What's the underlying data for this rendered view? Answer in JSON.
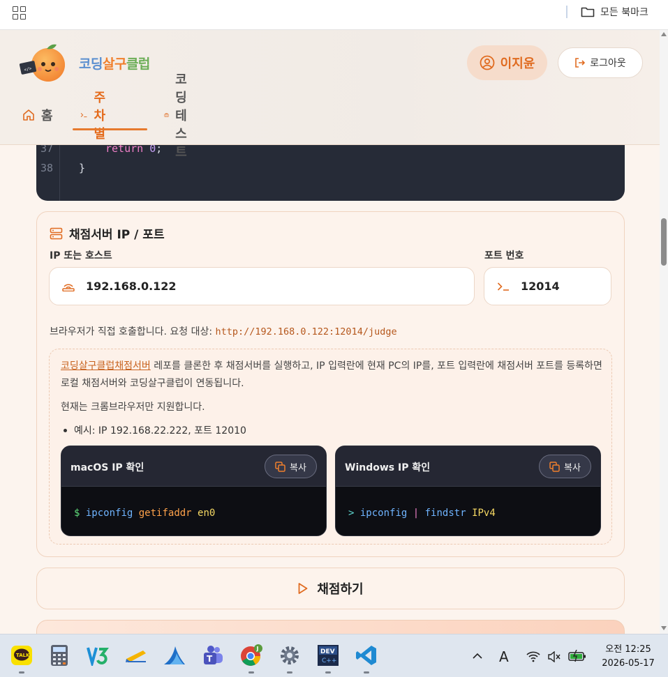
{
  "bookmarks_bar": {
    "folder_label": "모든 북마크"
  },
  "header": {
    "logo": {
      "part1": "코딩",
      "part2": "살구",
      "part3": "클럽"
    },
    "user_name": "이지윤",
    "logout_label": "로그아웃",
    "nav": [
      {
        "label": "홈",
        "icon": "home-icon"
      },
      {
        "label": "주차별",
        "icon": "terminal-icon",
        "active": true
      },
      {
        "label": "코딩테스트",
        "icon": "briefcase-icon"
      }
    ]
  },
  "code": {
    "lines": [
      {
        "num": "37",
        "keyword": "return",
        "value": "0",
        "suffix": ";"
      },
      {
        "num": "38",
        "text": "}"
      }
    ]
  },
  "server": {
    "title": "채점서버 IP / 포트",
    "ip_label": "IP 또는 호스트",
    "ip_value": "192.168.0.122",
    "port_label": "포트 번호",
    "port_value": "12014",
    "hint_prefix": "브라우저가 직접 호출합니다. 요청 대상:",
    "hint_url": "http://192.168.0.122:12014/judge",
    "notice": {
      "link": "코딩살구클럽채점서버",
      "text1": " 레포를 클론한 후 채점서버를 실행하고, IP 입력란에 현재 PC의 IP를, 포트 입력란에 채점서버 포트를 등록하면 로컬 채점서버와 코딩살구클럽이 연동됩니다.",
      "text2": "현재는 크롬브라우저만 지원합니다.",
      "example": "예시: IP 192.168.22.222, 포트 12010"
    },
    "terminals": [
      {
        "title": "macOS IP 확인",
        "copy": "복사",
        "prompt": "$",
        "cmd": "ipconfig",
        "arg1": "getifaddr",
        "arg2": "en0"
      },
      {
        "title": "Windows IP 확인",
        "copy": "복사",
        "prompt": ">",
        "cmd": "ipconfig",
        "pipe": "|",
        "arg1": "findstr",
        "arg2": "IPv4"
      }
    ]
  },
  "grade_button": "채점하기",
  "taskbar": {
    "apps": [
      "kakaotalk",
      "calculator",
      "v3",
      "notes",
      "browser",
      "teams",
      "chrome",
      "settings",
      "devcpp",
      "vscode"
    ],
    "ime": "A",
    "time": "오전 12:25",
    "date": "2026-05-17"
  },
  "colors": {
    "accent": "#e46a1a",
    "code_bg": "#262b37",
    "card_bg": "#fdf3ec"
  }
}
